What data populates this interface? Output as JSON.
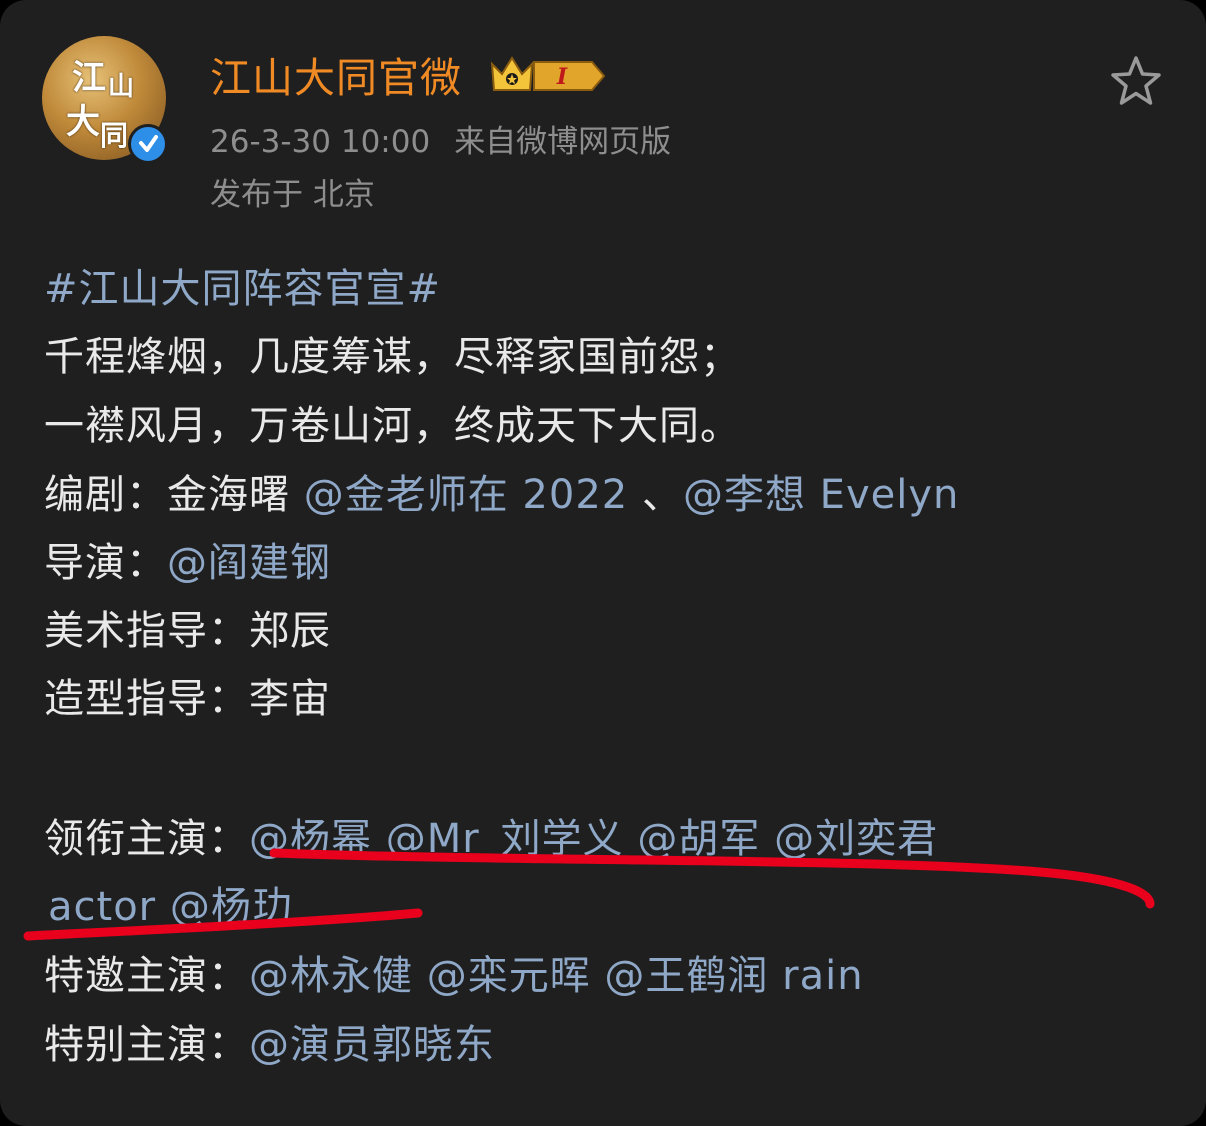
{
  "post": {
    "author": "江山大同官微",
    "level_badge": "I",
    "timestamp": "26-3-30 10:00",
    "source": "来自微博网页版",
    "location": "发布于 北京",
    "avatar_text": [
      "江",
      "山",
      "大",
      "同"
    ],
    "lines": {
      "hashtag": "#江山大同阵容官宣#",
      "poem1": "千程烽烟，几度筹谋，尽释家国前怨；",
      "poem2": "一襟风月，万卷山河，终成天下大同。",
      "writer_label": "编剧：",
      "writer_name": "金海曙 ",
      "writer_mention1": "@金老师在 2022",
      "writer_sep": " 、",
      "writer_mention2": "@李想 Evelyn",
      "director_label": "导演：",
      "director_mention": "@阎建钢",
      "art_label": "美术指导：",
      "art_name": "郑辰",
      "styling_label": "造型指导：",
      "styling_name": "李宙",
      "lead_label": "领衔主演：",
      "lead_mentions": "@杨幂 @Mr_刘学义 @胡军 @刘奕君",
      "lead_mentions2": "actor @杨玏",
      "guest_label": "特邀主演：",
      "guest_mentions": "@林永健 @栾元晖 @王鹤润 rain",
      "special_label": "特别主演：",
      "special_mentions": "@演员郭晓东"
    }
  },
  "colors": {
    "background": "#1f1f1f",
    "username": "#f08a24",
    "link": "#8fa8c8",
    "text": "#e9e9e9",
    "meta": "#8e8e8e",
    "annotation": "#e8001c",
    "verified": "#2e8fe8"
  },
  "icons": {
    "star": "star-outline-icon",
    "crown": "crown-icon",
    "verified": "verified-check-icon"
  }
}
